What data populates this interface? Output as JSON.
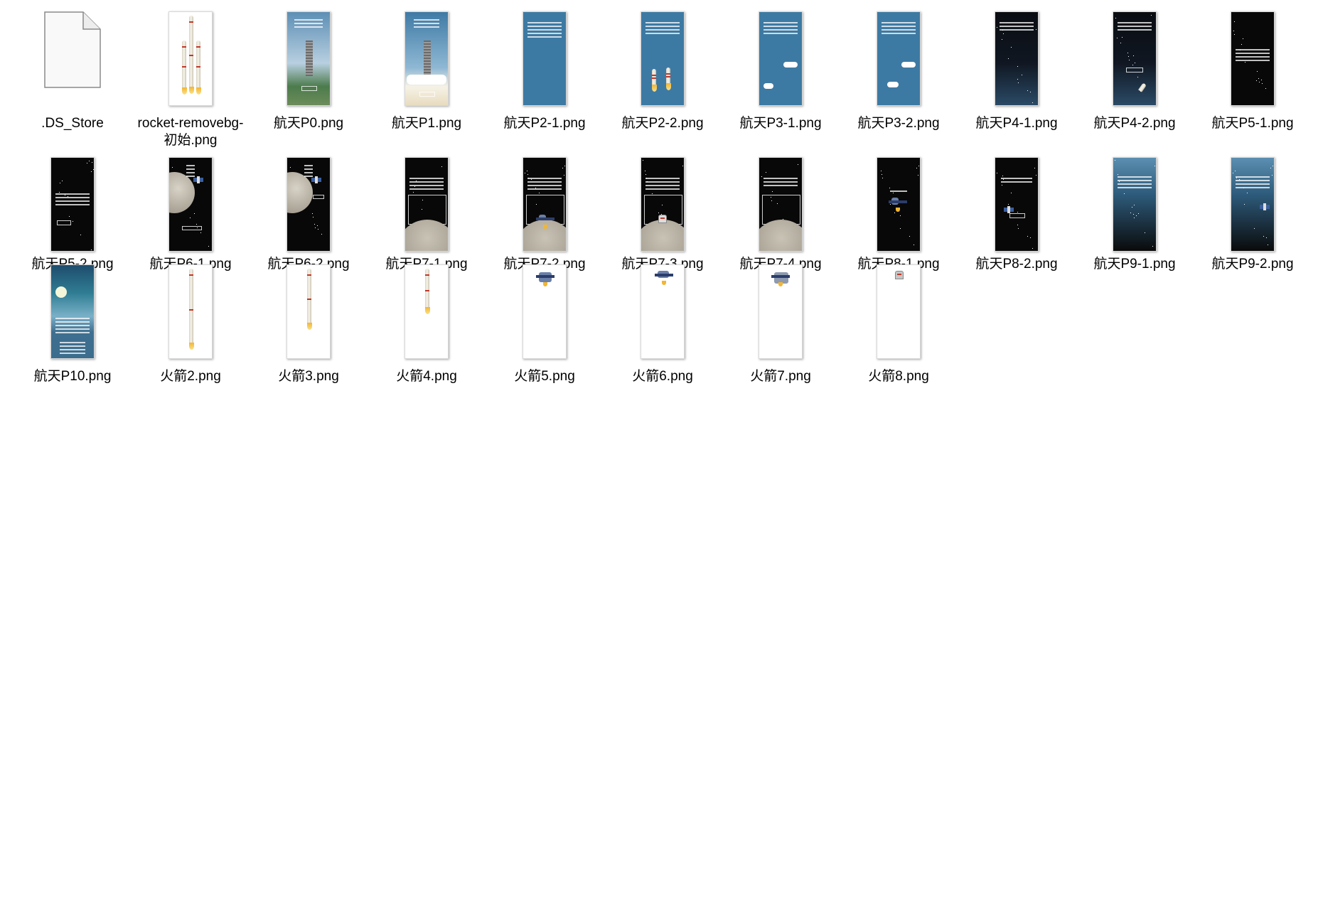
{
  "files": [
    {
      "name": ".DS_Store",
      "thumb": "file-icon"
    },
    {
      "name": "rocket-removebg-初始.png",
      "thumb": "rocket-full"
    },
    {
      "name": "航天P0.png",
      "thumb": "launch-pad"
    },
    {
      "name": "航天P1.png",
      "thumb": "liftoff"
    },
    {
      "name": "航天P2-1.png",
      "thumb": "blue-text"
    },
    {
      "name": "航天P2-2.png",
      "thumb": "blue-boosters"
    },
    {
      "name": "航天P3-1.png",
      "thumb": "blue-cloud"
    },
    {
      "name": "航天P3-2.png",
      "thumb": "blue-cloud-2"
    },
    {
      "name": "航天P4-1.png",
      "thumb": "night"
    },
    {
      "name": "航天P4-2.png",
      "thumb": "night-rocket"
    },
    {
      "name": "航天P5-1.png",
      "thumb": "space-text"
    },
    {
      "name": "航天P5-2.png",
      "thumb": "space-button"
    },
    {
      "name": "航天P6-1.png",
      "thumb": "moon-left"
    },
    {
      "name": "航天P6-2.png",
      "thumb": "moon-left-2"
    },
    {
      "name": "航天P7-1.png",
      "thumb": "moon-bottom"
    },
    {
      "name": "航天P7-2.png",
      "thumb": "moon-lander"
    },
    {
      "name": "航天P7-3.png",
      "thumb": "moon-astronaut"
    },
    {
      "name": "航天P7-4.png",
      "thumb": "moon-bottom-2"
    },
    {
      "name": "航天P8-1.png",
      "thumb": "space-probe"
    },
    {
      "name": "航天P8-2.png",
      "thumb": "space-probe-2"
    },
    {
      "name": "航天P9-1.png",
      "thumb": "dusk"
    },
    {
      "name": "航天P9-2.png",
      "thumb": "dusk-sat"
    },
    {
      "name": "航天P10.png",
      "thumb": "poster"
    },
    {
      "name": "火箭2.png",
      "thumb": "rocket-stage-2"
    },
    {
      "name": "火箭3.png",
      "thumb": "rocket-stage-3"
    },
    {
      "name": "火箭4.png",
      "thumb": "rocket-stage-4"
    },
    {
      "name": "火箭5.png",
      "thumb": "probe-top"
    },
    {
      "name": "火箭6.png",
      "thumb": "probe-top-small"
    },
    {
      "name": "火箭7.png",
      "thumb": "probe-capsule"
    },
    {
      "name": "火箭8.png",
      "thumb": "capsule-small"
    }
  ]
}
